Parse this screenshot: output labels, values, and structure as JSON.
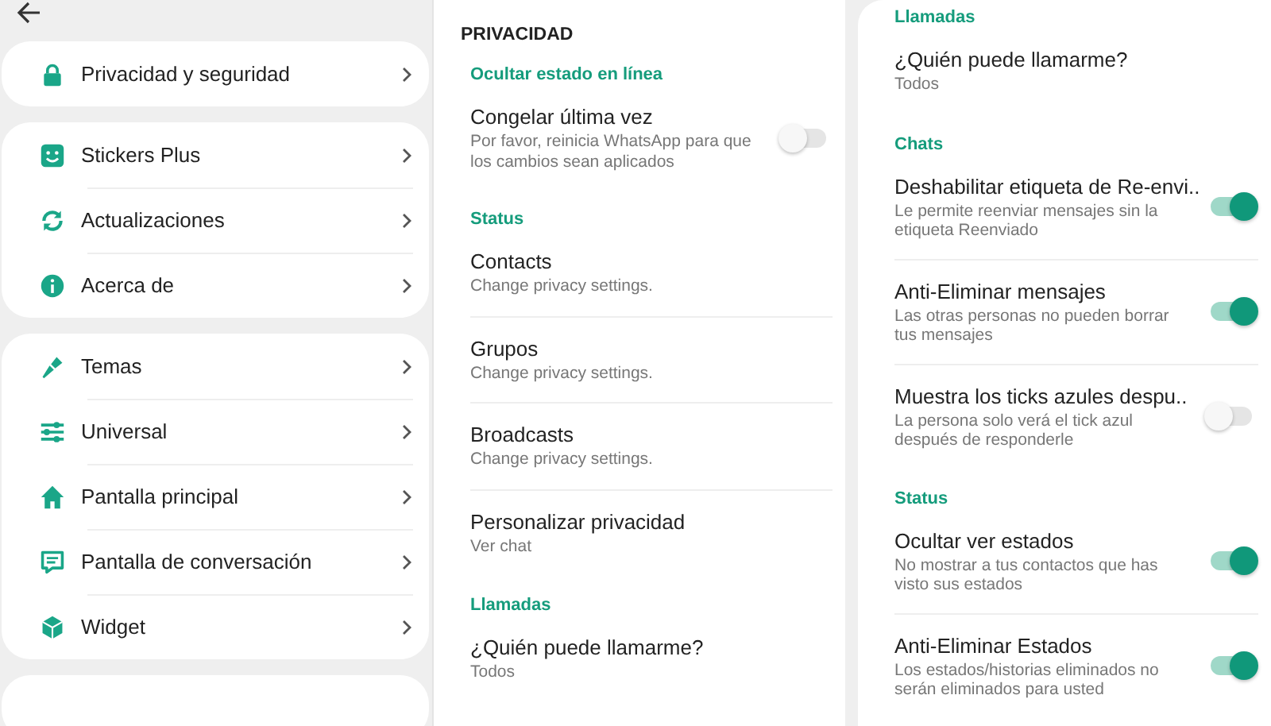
{
  "menu": {
    "groups": [
      {
        "items": [
          {
            "label": "Privacidad y seguridad"
          }
        ]
      },
      {
        "items": [
          {
            "label": "Stickers Plus"
          },
          {
            "label": "Actualizaciones"
          },
          {
            "label": "Acerca de"
          }
        ]
      },
      {
        "items": [
          {
            "label": "Temas"
          },
          {
            "label": "Universal"
          },
          {
            "label": "Pantalla principal"
          },
          {
            "label": "Pantalla de conversación"
          },
          {
            "label": "Widget"
          }
        ]
      }
    ]
  },
  "privacy": {
    "title": "PRIVACIDAD",
    "sections": [
      {
        "heading": "Ocultar estado en línea",
        "items": [
          {
            "kind": "toggle",
            "title": "Congelar última vez",
            "subtitle": "Por favor, reinicia WhatsApp para que los cambios sean aplicados",
            "on": false
          }
        ]
      },
      {
        "heading": "Status",
        "items": [
          {
            "kind": "link",
            "title": "Contacts",
            "subtitle": "Change privacy settings."
          },
          {
            "kind": "link",
            "title": "Grupos",
            "subtitle": "Change privacy settings."
          },
          {
            "kind": "link",
            "title": "Broadcasts",
            "subtitle": "Change privacy settings."
          },
          {
            "kind": "link",
            "title": "Personalizar privacidad",
            "subtitle": "Ver chat"
          }
        ]
      },
      {
        "heading": "Llamadas",
        "items": [
          {
            "kind": "link",
            "title": "¿Quién puede llamarme?",
            "subtitle": "Todos"
          }
        ]
      }
    ]
  },
  "privacy_continued": {
    "sections": [
      {
        "heading": "Llamadas",
        "items": [
          {
            "kind": "link",
            "title": "¿Quién puede llamarme?",
            "subtitle": "Todos"
          }
        ]
      },
      {
        "heading": "Chats",
        "items": [
          {
            "kind": "toggle",
            "title": "Deshabilitar etiqueta de Re-envi..",
            "subtitle": "Le permite reenviar mensajes sin la etiqueta Reenviado",
            "on": true
          },
          {
            "kind": "toggle",
            "title": "Anti-Eliminar mensajes",
            "subtitle": "Las otras personas no pueden borrar tus mensajes",
            "on": true
          },
          {
            "kind": "toggle",
            "title": "Muestra los ticks azules despu..",
            "subtitle": "La persona solo verá el tick azul después de responderle",
            "on": false
          }
        ]
      },
      {
        "heading": "Status",
        "items": [
          {
            "kind": "toggle",
            "title": "Ocultar ver estados",
            "subtitle": "No mostrar a tus contactos que has visto sus estados",
            "on": true
          },
          {
            "kind": "toggle",
            "title": "Anti-Eliminar Estados",
            "subtitle": "Los estados/historias eliminados no serán eliminados para usted",
            "on": true
          }
        ]
      }
    ]
  }
}
